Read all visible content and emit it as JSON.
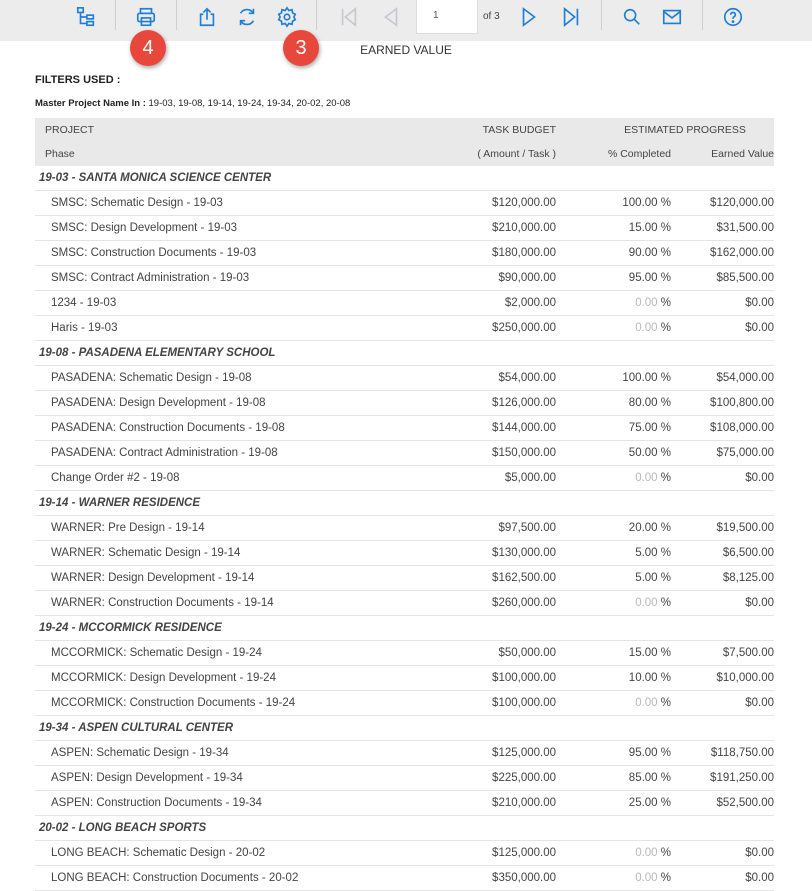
{
  "toolbar": {
    "page_value": "1",
    "of_label": "of 3",
    "accent": "#1e7fd6"
  },
  "callouts": {
    "print": "4",
    "settings": "3"
  },
  "report": {
    "title": "EARNED VALUE",
    "filters_heading": "FILTERS USED :",
    "filter_label": "Master Project Name In :",
    "filter_value": "19-03, 19-08, 19-14, 19-24, 19-34, 20-02, 20-08"
  },
  "table": {
    "headers": {
      "project": "PROJECT",
      "task_budget": "TASK BUDGET",
      "estimated_progress": "ESTIMATED PROGRESS",
      "phase": "Phase",
      "amount_task": "( Amount / Task )",
      "pct_completed": "% Completed",
      "earned_value": "Earned Value"
    },
    "groups": [
      {
        "name": "19-03 - SANTA MONICA SCIENCE CENTER",
        "rows": [
          {
            "phase": "SMSC: Schematic Design - 19-03",
            "budget": "$120,000.00",
            "pct": "100.00",
            "ev": "$120,000.00"
          },
          {
            "phase": "SMSC: Design Development - 19-03",
            "budget": "$210,000.00",
            "pct": "15.00",
            "ev": "$31,500.00"
          },
          {
            "phase": "SMSC: Construction Documents - 19-03",
            "budget": "$180,000.00",
            "pct": "90.00",
            "ev": "$162,000.00"
          },
          {
            "phase": "SMSC: Contract Administration - 19-03",
            "budget": "$90,000.00",
            "pct": "95.00",
            "ev": "$85,500.00"
          },
          {
            "phase": "1234 - 19-03",
            "budget": "$2,000.00",
            "pct": "0.00",
            "ev": "$0.00"
          },
          {
            "phase": "Haris - 19-03",
            "budget": "$250,000.00",
            "pct": "0.00",
            "ev": "$0.00"
          }
        ]
      },
      {
        "name": "19-08 - PASADENA ELEMENTARY SCHOOL",
        "rows": [
          {
            "phase": "PASADENA: Schematic Design - 19-08",
            "budget": "$54,000.00",
            "pct": "100.00",
            "ev": "$54,000.00"
          },
          {
            "phase": "PASADENA: Design Development - 19-08",
            "budget": "$126,000.00",
            "pct": "80.00",
            "ev": "$100,800.00"
          },
          {
            "phase": "PASADENA: Construction Documents - 19-08",
            "budget": "$144,000.00",
            "pct": "75.00",
            "ev": "$108,000.00"
          },
          {
            "phase": "PASADENA: Contract Administration - 19-08",
            "budget": "$150,000.00",
            "pct": "50.00",
            "ev": "$75,000.00"
          },
          {
            "phase": "Change Order #2 - 19-08",
            "budget": "$5,000.00",
            "pct": "0.00",
            "ev": "$0.00"
          }
        ]
      },
      {
        "name": "19-14 - WARNER RESIDENCE",
        "rows": [
          {
            "phase": "WARNER: Pre Design - 19-14",
            "budget": "$97,500.00",
            "pct": "20.00",
            "ev": "$19,500.00"
          },
          {
            "phase": "WARNER: Schematic Design - 19-14",
            "budget": "$130,000.00",
            "pct": "5.00",
            "ev": "$6,500.00"
          },
          {
            "phase": "WARNER: Design Development - 19-14",
            "budget": "$162,500.00",
            "pct": "5.00",
            "ev": "$8,125.00"
          },
          {
            "phase": "WARNER: Construction Documents - 19-14",
            "budget": "$260,000.00",
            "pct": "0.00",
            "ev": "$0.00"
          }
        ]
      },
      {
        "name": "19-24 - MCCORMICK RESIDENCE",
        "rows": [
          {
            "phase": "MCCORMICK: Schematic Design - 19-24",
            "budget": "$50,000.00",
            "pct": "15.00",
            "ev": "$7,500.00"
          },
          {
            "phase": "MCCORMICK: Design Development - 19-24",
            "budget": "$100,000.00",
            "pct": "10.00",
            "ev": "$10,000.00"
          },
          {
            "phase": "MCCORMICK: Construction Documents - 19-24",
            "budget": "$100,000.00",
            "pct": "0.00",
            "ev": "$0.00"
          }
        ]
      },
      {
        "name": "19-34 - ASPEN CULTURAL CENTER",
        "rows": [
          {
            "phase": "ASPEN: Schematic Design - 19-34",
            "budget": "$125,000.00",
            "pct": "95.00",
            "ev": "$118,750.00"
          },
          {
            "phase": "ASPEN: Design Development - 19-34",
            "budget": "$225,000.00",
            "pct": "85.00",
            "ev": "$191,250.00"
          },
          {
            "phase": "ASPEN: Construction Documents - 19-34",
            "budget": "$210,000.00",
            "pct": "25.00",
            "ev": "$52,500.00"
          }
        ]
      },
      {
        "name": "20-02 - LONG BEACH SPORTS",
        "rows": [
          {
            "phase": "LONG BEACH: Schematic Design - 20-02",
            "budget": "$125,000.00",
            "pct": "0.00",
            "ev": "$0.00"
          },
          {
            "phase": "LONG BEACH: Construction Documents - 20-02",
            "budget": "$350,000.00",
            "pct": "0.00",
            "ev": "$0.00"
          }
        ]
      }
    ]
  }
}
